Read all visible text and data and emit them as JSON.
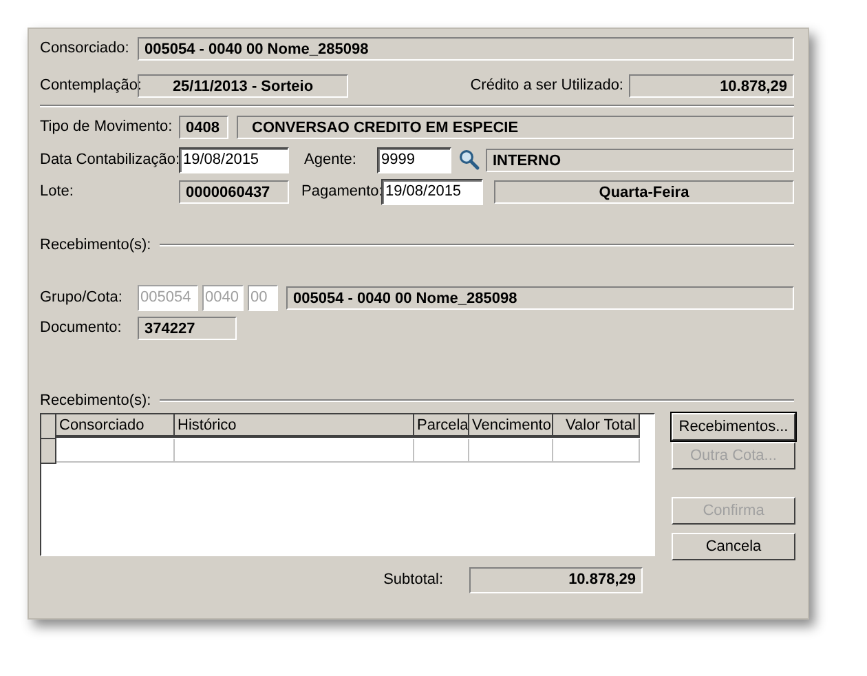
{
  "consorciado": {
    "label": "Consorciado:",
    "value": "005054 - 0040 00  Nome_285098"
  },
  "contemplacao": {
    "label": "Contemplação:",
    "value": "25/11/2013 - Sorteio"
  },
  "credito": {
    "label": "Crédito a ser Utilizado:",
    "value": "10.878,29"
  },
  "tipo_movimento": {
    "label": "Tipo de Movimento:",
    "code": "0408",
    "description": "CONVERSAO CREDITO EM ESPECIE"
  },
  "data_contabilizacao": {
    "label": "Data Contabilização:",
    "value": "19/08/2015"
  },
  "agente": {
    "label": "Agente:",
    "value": "9999",
    "name": "INTERNO"
  },
  "lote": {
    "label": "Lote:",
    "value": "0000060437"
  },
  "pagamento": {
    "label": "Pagamento:",
    "value": "19/08/2015",
    "weekday": "Quarta-Feira"
  },
  "section_1": {
    "title": "Recebimento(s):"
  },
  "grupo_cota": {
    "label": "Grupo/Cota:",
    "fields": [
      {
        "value": "005054",
        "disabled": true
      },
      {
        "value": "0040",
        "disabled": true
      },
      {
        "value": "00",
        "disabled": true
      }
    ],
    "description": "005054 - 0040 00  Nome_285098"
  },
  "documento": {
    "label": "Documento:",
    "value": "374227"
  },
  "section_2": {
    "title": "Recebimento(s):"
  },
  "table": {
    "columns": [
      "Consorciado",
      "Histórico",
      "Parcela",
      "Vencimento",
      "Valor Total"
    ]
  },
  "buttons": [
    {
      "label": "Recebimentos...",
      "disabled": false,
      "default": true
    },
    {
      "label": "Outra Cota...",
      "disabled": true,
      "default": false
    },
    {
      "label": "Confirma",
      "disabled": true,
      "default": false
    },
    {
      "label": "Cancela",
      "disabled": false,
      "default": false
    }
  ],
  "subtotal": {
    "label": "Subtotal:",
    "value": "10.878,29"
  }
}
